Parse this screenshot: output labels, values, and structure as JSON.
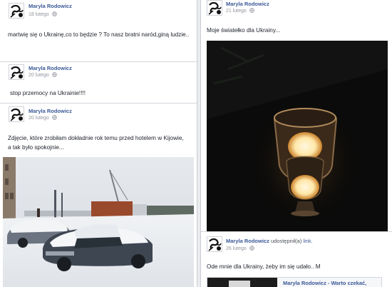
{
  "posts_left": [
    {
      "author": "Maryla Rodowicz",
      "date": "18 lutego",
      "text": "martwię się o Ukrainę,co to będzie ? To nasz bratni naród,giną ludzie.."
    },
    {
      "author": "Maryla Rodowicz",
      "date": "20 lutego",
      "text": "stop przemocy na Ukrainie!!!!"
    },
    {
      "author": "Maryla Rodowicz",
      "date": "20 lutego",
      "text": "Zdjęcie, które zrobiłam dokładnie rok temu przed hotelem w Kijowie, a tak było spokojnie..."
    }
  ],
  "posts_right": [
    {
      "author": "Maryla Rodowicz",
      "date": "21 lutego",
      "text": "Moje światełko dla Ukrainy..."
    },
    {
      "author": "Maryla Rodowicz",
      "shared_label": "udostępnił(a)",
      "shared_link": "link.",
      "date": "26 lutego",
      "text": "Ode mnie dla Ukrainy, żeby im się udało.. M",
      "link_preview_title": "Maryla Rodowicz - Warto czekać,"
    }
  ],
  "colors": {
    "author_name": "#3b5998",
    "meta_gray": "#90949c",
    "text": "#1d2129",
    "background": "#e9ebee"
  },
  "icons": {
    "audience": "globe-icon",
    "avatar": "profile-photo"
  }
}
